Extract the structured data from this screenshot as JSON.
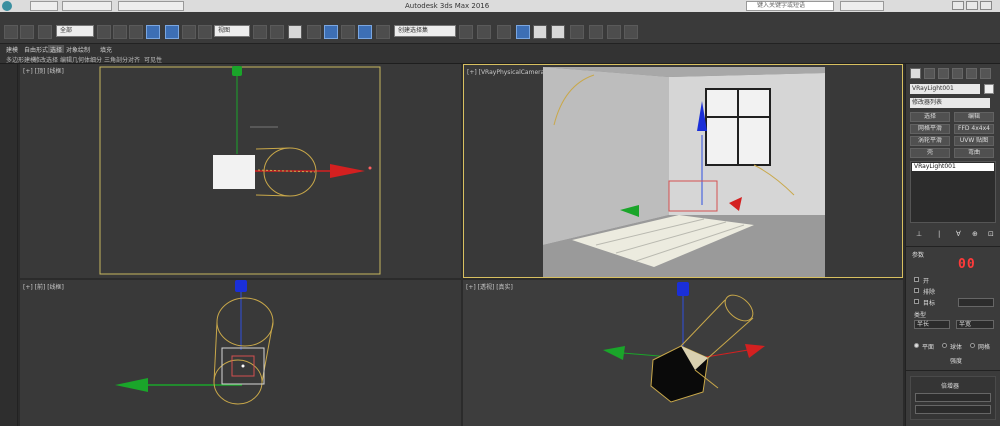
{
  "window": {
    "title": "Autodesk 3ds Max 2016",
    "search_placeholder": "键入关键字或短语"
  },
  "toolbar": {
    "selection_filter": "全部",
    "reference_coord": "视图",
    "named_selection": "创建选择集"
  },
  "ribbon": {
    "tabs": [
      "建模",
      "自由形式",
      "选择",
      "对象绘制",
      "填充"
    ],
    "subtabs": [
      "多边形建模",
      "修改选择",
      "编辑",
      "几何体",
      "细分",
      "三角剖分",
      "对齐",
      "可见性"
    ]
  },
  "viewports": {
    "top": "[+] [顶] [线框]",
    "camera": "[+] [VRayPhysicalCamera001] [真实]",
    "front": "[+] [前] [线框]",
    "perspective": "[+] [透视] [真实]"
  },
  "command_panel": {
    "object_name": "VRayLight001",
    "modifier_list": "修改器列表",
    "buttons": [
      "选择",
      "编辑",
      "网格平滑",
      "FFD 4x4x4",
      "涡轮平滑",
      "UVW 贴图",
      "壳",
      "弯曲"
    ],
    "stack_item": "VRayLight001",
    "parameters_title": "参数",
    "led_value": "00",
    "checkboxes": [
      "开",
      "排除",
      "目标"
    ],
    "option_label": "类型",
    "spinner_labels": [
      "半长",
      "半宽"
    ],
    "radio_labels": [
      "平面",
      "球体",
      "网格"
    ],
    "footer": "强度",
    "footer2": "倍增器"
  },
  "colors": {
    "gizmo_red": "#d42020",
    "gizmo_green": "#1aa52a",
    "gizmo_blue": "#1a2fd8",
    "light_outline": "#c9a84a",
    "active_viewport": "#d8c060"
  }
}
